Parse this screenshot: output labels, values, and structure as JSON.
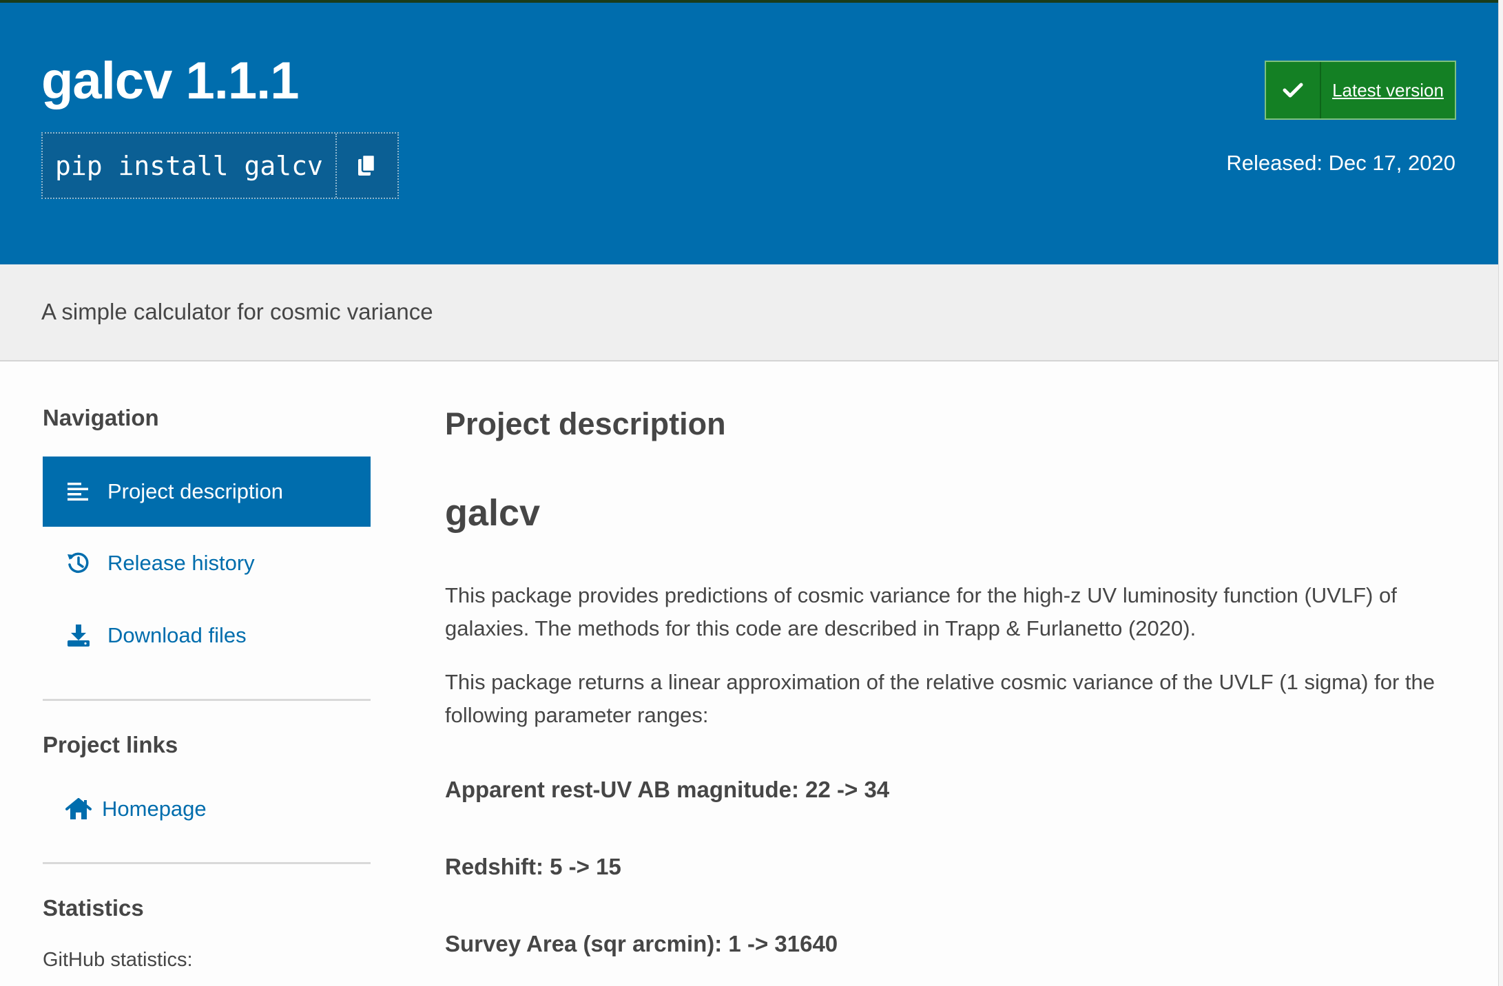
{
  "header": {
    "package_title": "galcv 1.1.1",
    "pip_command": "pip install galcv",
    "copy_icon": "copy-icon",
    "latest_version_label": "Latest version",
    "check_icon": "check-icon",
    "released_text": "Released: Dec 17, 2020"
  },
  "summary": "A simple calculator for cosmic variance",
  "sidebar": {
    "navigation_heading": "Navigation",
    "nav_items": [
      {
        "label": "Project description",
        "icon": "align-left-icon",
        "active": true
      },
      {
        "label": "Release history",
        "icon": "history-icon",
        "active": false
      },
      {
        "label": "Download files",
        "icon": "download-icon",
        "active": false
      }
    ],
    "project_links_heading": "Project links",
    "project_links": [
      {
        "label": "Homepage",
        "icon": "home-icon"
      }
    ],
    "statistics_heading": "Statistics",
    "github_stats_label": "GitHub statistics:"
  },
  "main": {
    "section_heading": "Project description",
    "readme_title": "galcv",
    "paragraph_1": "This package provides predictions of cosmic variance for the high-z UV luminosity function (UVLF) of galaxies. The methods for this code are described in Trapp & Furlanetto (2020).",
    "paragraph_2": "This package returns a linear approximation of the relative cosmic variance of the UVLF (1 sigma) for the following parameter ranges:",
    "param_1": "Apparent rest-UV AB magnitude: 22 -> 34",
    "param_2": "Redshift: 5 -> 15",
    "param_3": "Survey Area (sqr arcmin): 1 -> 31640"
  },
  "colors": {
    "header_blue": "#006dad",
    "latest_green": "#148024",
    "summary_band": "#efefef",
    "text": "#464646"
  }
}
